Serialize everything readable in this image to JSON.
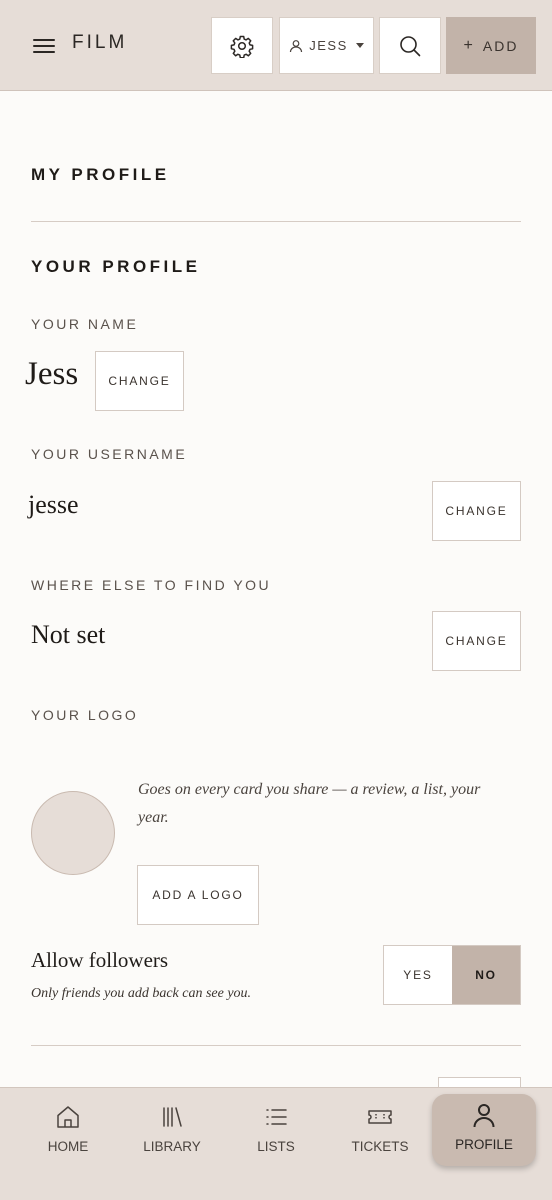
{
  "header": {
    "brand": "FILM",
    "user_label": "JESS",
    "add_label": "ADD",
    "add_icon": "plus-icon"
  },
  "page": {
    "title": "MY PROFILE",
    "section_title": "YOUR PROFILE"
  },
  "profile": {
    "name_label": "YOUR NAME",
    "name_value": "Jess",
    "username_label": "YOUR USERNAME",
    "username_value": "jesse",
    "links_label": "WHERE ELSE TO FIND YOU",
    "links_value": "Not set",
    "change_label": "CHANGE",
    "logo_label": "YOUR LOGO",
    "logo_description": "Goes on every card you share — a review, a list, your year.",
    "add_logo_label": "ADD A LOGO"
  },
  "followers": {
    "title": "Allow followers",
    "subtitle": "Only friends you add back can see you.",
    "yes_label": "YES",
    "no_label": "NO",
    "selected": "NO"
  },
  "nav": {
    "items": [
      {
        "label": "HOME",
        "icon": "home-icon"
      },
      {
        "label": "LIBRARY",
        "icon": "library-icon"
      },
      {
        "label": "LISTS",
        "icon": "list-icon"
      },
      {
        "label": "TICKETS",
        "icon": "ticket-icon"
      },
      {
        "label": "PROFILE",
        "icon": "profile-icon"
      }
    ],
    "active": "PROFILE"
  },
  "colors": {
    "header_bg": "#e6ddd7",
    "accent": "#c2b3a9",
    "page_bg": "#fcfbf9",
    "text": "#1f1b18"
  }
}
